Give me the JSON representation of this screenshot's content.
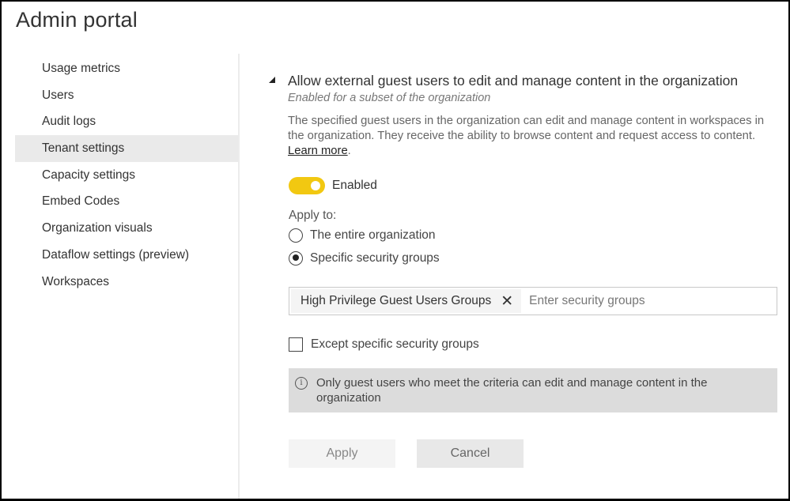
{
  "header": {
    "title": "Admin portal"
  },
  "sidebar": {
    "items": [
      {
        "label": "Usage metrics",
        "active": false
      },
      {
        "label": "Users",
        "active": false
      },
      {
        "label": "Audit logs",
        "active": false
      },
      {
        "label": "Tenant settings",
        "active": true
      },
      {
        "label": "Capacity settings",
        "active": false
      },
      {
        "label": "Embed Codes",
        "active": false
      },
      {
        "label": "Organization visuals",
        "active": false
      },
      {
        "label": "Dataflow settings (preview)",
        "active": false
      },
      {
        "label": "Workspaces",
        "active": false
      }
    ]
  },
  "setting": {
    "title": "Allow external guest users to edit and manage content in the organization",
    "subtitle": "Enabled for a subset of the organization",
    "description": "The specified guest users in the organization can edit and manage content in workspaces in the organization. They receive the ability to browse content and request access to content.",
    "learn_more": "Learn more",
    "toggle": {
      "label": "Enabled",
      "on": true,
      "color": "#f2c811"
    },
    "apply_to_label": "Apply to:",
    "radio_options": [
      {
        "label": "The entire organization",
        "checked": false
      },
      {
        "label": "Specific security groups",
        "checked": true
      }
    ],
    "groups": {
      "chips": [
        "High Privilege Guest Users Groups"
      ],
      "placeholder": "Enter security groups"
    },
    "except_checkbox": {
      "label": "Except specific security groups",
      "checked": false
    },
    "info": "Only guest users who meet the criteria can edit and manage content in the organization",
    "buttons": {
      "apply": "Apply",
      "cancel": "Cancel"
    }
  }
}
